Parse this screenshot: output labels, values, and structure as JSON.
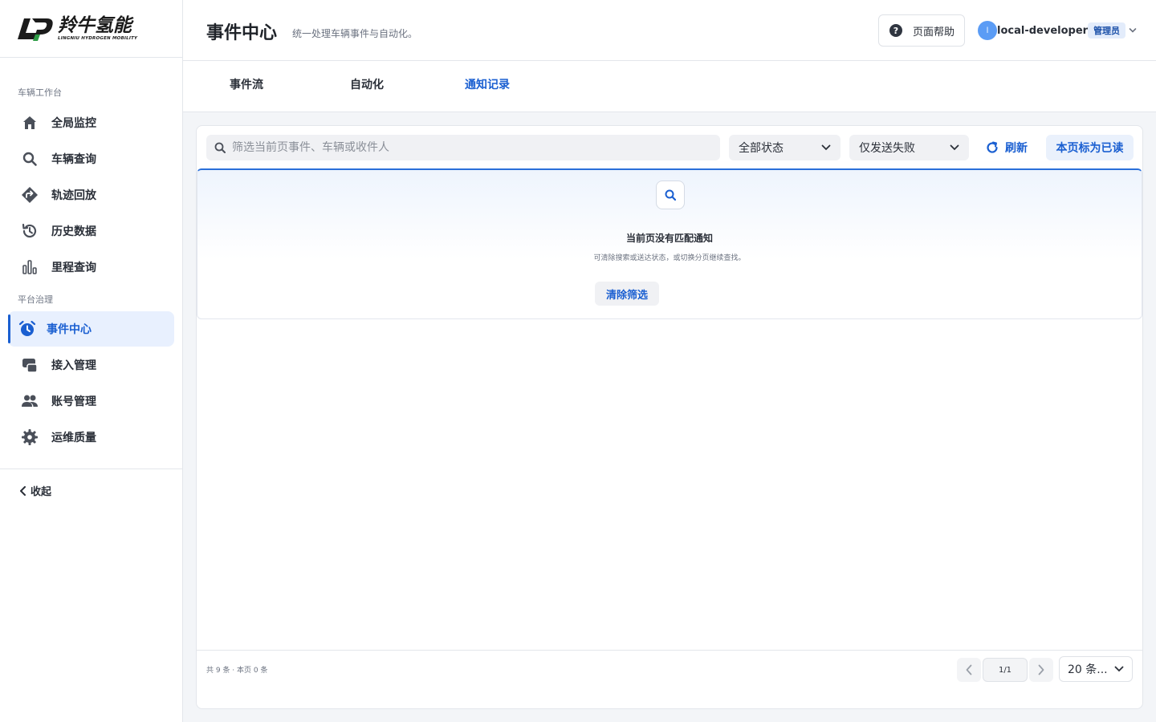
{
  "brand": {
    "logo_cn": "羚牛氢能",
    "logo_en": "LINGNIU HYDROGEN MOBILITY"
  },
  "sidebar": {
    "group_vehicle": "车辆工作台",
    "group_platform": "平台治理",
    "items": [
      {
        "label": "全局监控",
        "icon": "home-icon"
      },
      {
        "label": "车辆查询",
        "icon": "search-icon"
      },
      {
        "label": "轨迹回放",
        "icon": "route-icon"
      },
      {
        "label": "历史数据",
        "icon": "history-icon"
      },
      {
        "label": "里程查询",
        "icon": "bar-chart-icon"
      },
      {
        "label": "事件中心",
        "icon": "alarm-clock-icon",
        "active": true
      },
      {
        "label": "接入管理",
        "icon": "access-icon"
      },
      {
        "label": "账号管理",
        "icon": "users-icon"
      },
      {
        "label": "运维质量",
        "icon": "gear-icon"
      }
    ],
    "collapse_label": "收起"
  },
  "header": {
    "title": "事件中心",
    "subtitle": "统一处理车辆事件与自动化。",
    "help_label": "页面帮助",
    "user_initial": "l",
    "user_name": "local-developer",
    "role": "管理员"
  },
  "tabs": [
    {
      "label": "事件流",
      "active": false
    },
    {
      "label": "自动化",
      "active": false
    },
    {
      "label": "通知记录",
      "active": true
    }
  ],
  "toolbar": {
    "search_placeholder": "筛选当前页事件、车辆或收件人",
    "status_select": "全部状态",
    "delivery_select": "仅发送失败",
    "refresh_label": "刷新",
    "mark_read_label": "本页标为已读"
  },
  "empty_state": {
    "title": "当前页没有匹配通知",
    "description": "可清除搜索或送达状态，或切换分页继续查找。",
    "clear_label": "清除筛选"
  },
  "pagination": {
    "summary": "共 9 条 · 本页 0 条",
    "current": "1/1",
    "page_size": "20 条..."
  },
  "colors": {
    "accent": "#1a5fd1",
    "active_bg": "#e8f0fe",
    "avatar": "#5b9cf5"
  }
}
